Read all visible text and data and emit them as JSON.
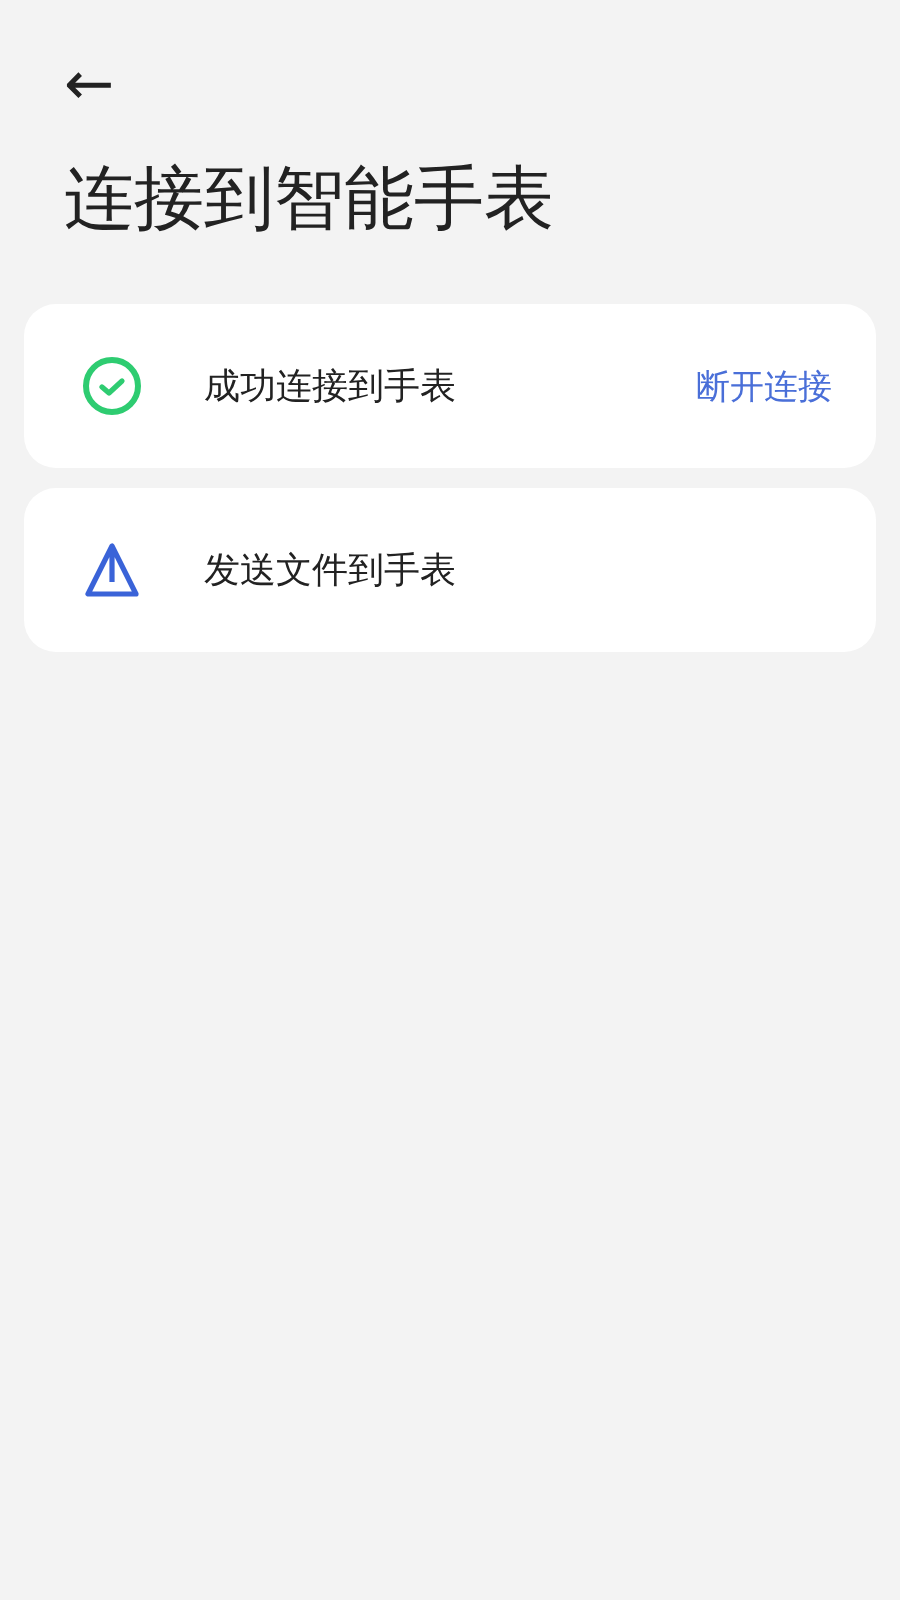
{
  "back": "←",
  "title": "连接到智能手表",
  "cards": [
    {
      "kind": "connected",
      "label": "成功连接到手表",
      "action": "断开连接"
    },
    {
      "kind": "send",
      "label": "发送文件到手表"
    }
  ]
}
